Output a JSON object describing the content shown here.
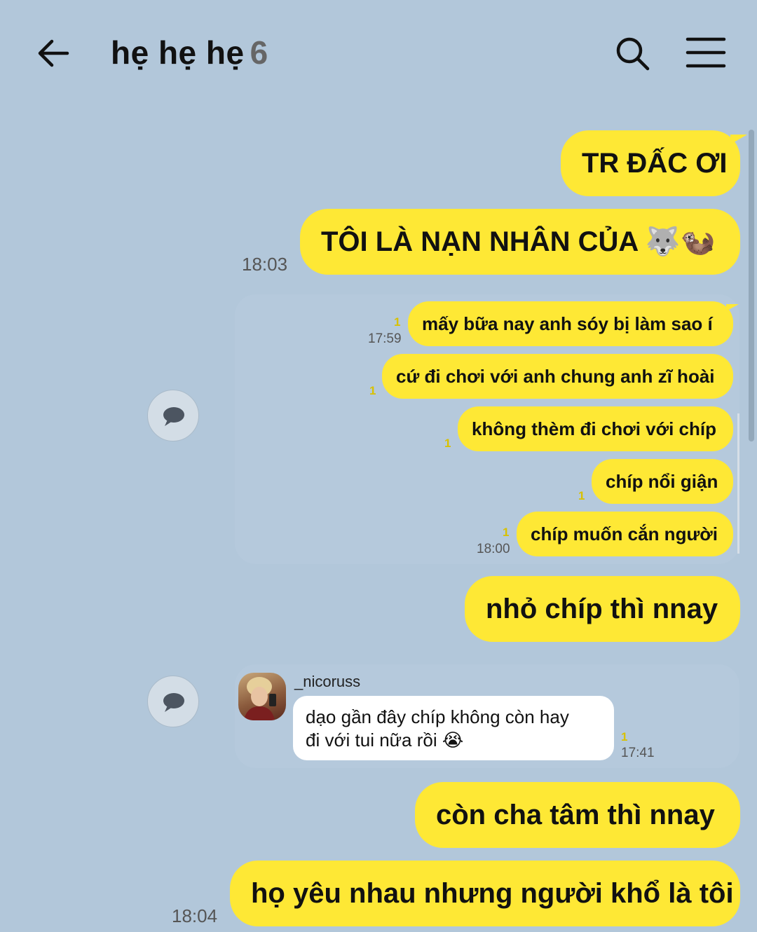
{
  "header": {
    "title": "hẹ hẹ hẹ",
    "member_count": "6",
    "icons": {
      "back": "arrow-left-icon",
      "search": "search-icon",
      "menu": "hamburger-menu-icon"
    }
  },
  "messages": {
    "m1": "TR ĐẤC ƠI",
    "m2": "TÔI LÀ NẠN NHÂN CỦA 🐺🦦",
    "m2_time": "18:03",
    "quoted_1": {
      "lines": [
        {
          "text": "mấy bữa nay anh sóy bị làm sao í",
          "unread": "1",
          "time": "17:59"
        },
        {
          "text": "cứ đi chơi với anh chung anh zĩ hoài",
          "unread": "1"
        },
        {
          "text": "không thèm đi chơi với chíp",
          "unread": "1"
        },
        {
          "text": "chíp nổi giận",
          "unread": "1"
        },
        {
          "text": "chíp muốn cắn người",
          "unread": "1",
          "time": "18:00"
        }
      ]
    },
    "m3": "nhỏ chíp thì nnay",
    "quoted_2": {
      "sender": "_nicoruss",
      "line1": "dạo gần đây chíp không còn hay",
      "line2": "đi với tui nữa rồi 😭",
      "unread": "1",
      "time": "17:41"
    },
    "m4": "còn cha tâm thì nnay",
    "m5": "họ yêu nhau nhưng người khổ là tôi",
    "m5_time": "18:04"
  },
  "colors": {
    "background": "#b2c7da",
    "bubble": "#fee835",
    "unread": "#d8c100"
  }
}
